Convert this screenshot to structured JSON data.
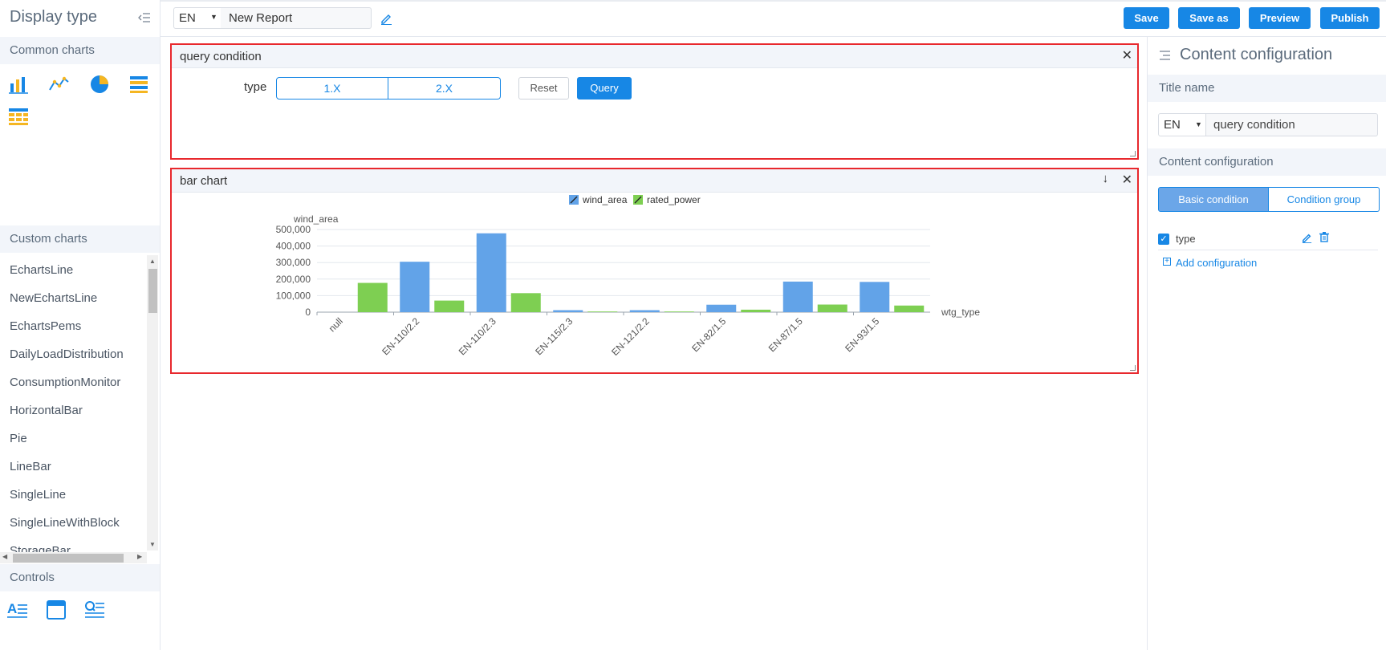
{
  "left_panel": {
    "title": "Display type",
    "common_charts_label": "Common charts",
    "common_chart_icons": [
      "bar-chart-icon",
      "line-chart-icon",
      "pie-chart-icon",
      "table-icon",
      "grid-table-icon"
    ],
    "custom_charts_label": "Custom charts",
    "custom_charts": [
      "EchartsLine",
      "NewEchartsLine",
      "EchartsPems",
      "DailyLoadDistribution",
      "ConsumptionMonitor",
      "HorizontalBar",
      "Pie",
      "LineBar",
      "SingleLine",
      "SingleLineWithBlock",
      "StorageBar"
    ],
    "controls_label": "Controls",
    "control_icons": [
      "text-control-icon",
      "window-control-icon",
      "search-control-icon"
    ]
  },
  "topbar": {
    "lang": "EN",
    "report_name": "New Report",
    "buttons": {
      "save": "Save",
      "save_as": "Save as",
      "preview": "Preview",
      "publish": "Publish"
    }
  },
  "query_panel": {
    "title": "query condition",
    "field_label": "type",
    "options": [
      "1.X",
      "2.X"
    ],
    "reset": "Reset",
    "query": "Query"
  },
  "chart_panel": {
    "title": "bar chart"
  },
  "chart_data": {
    "type": "bar",
    "categories": [
      "null",
      "EN-110/2.2",
      "EN-110/2.3",
      "EN-115/2.3",
      "EN-121/2.2",
      "EN-82/1.5",
      "EN-87/1.5",
      "EN-93/1.5"
    ],
    "series": [
      {
        "name": "wind_area",
        "color": "#62a3e8",
        "values": [
          0,
          305000,
          477000,
          12000,
          12000,
          45000,
          185000,
          183000
        ]
      },
      {
        "name": "rated_power",
        "color": "#7ecf52",
        "values": [
          177000,
          70000,
          115000,
          4000,
          4000,
          15000,
          46000,
          40000
        ]
      }
    ],
    "ylabel": "wind_area",
    "xlabel": "wtg_type",
    "ylim": [
      0,
      500000
    ],
    "yticks": [
      "0",
      "100,000",
      "200,000",
      "300,000",
      "400,000",
      "500,000"
    ],
    "grid": true,
    "legend": "top-center"
  },
  "right_panel": {
    "title": "Content configuration",
    "title_name_label": "Title name",
    "lang": "EN",
    "title_value": "query condition",
    "content_label": "Content configuration",
    "tabs": [
      "Basic condition",
      "Condition group"
    ],
    "items": [
      {
        "label": "type",
        "checked": true
      }
    ],
    "add_label": "Add configuration"
  }
}
